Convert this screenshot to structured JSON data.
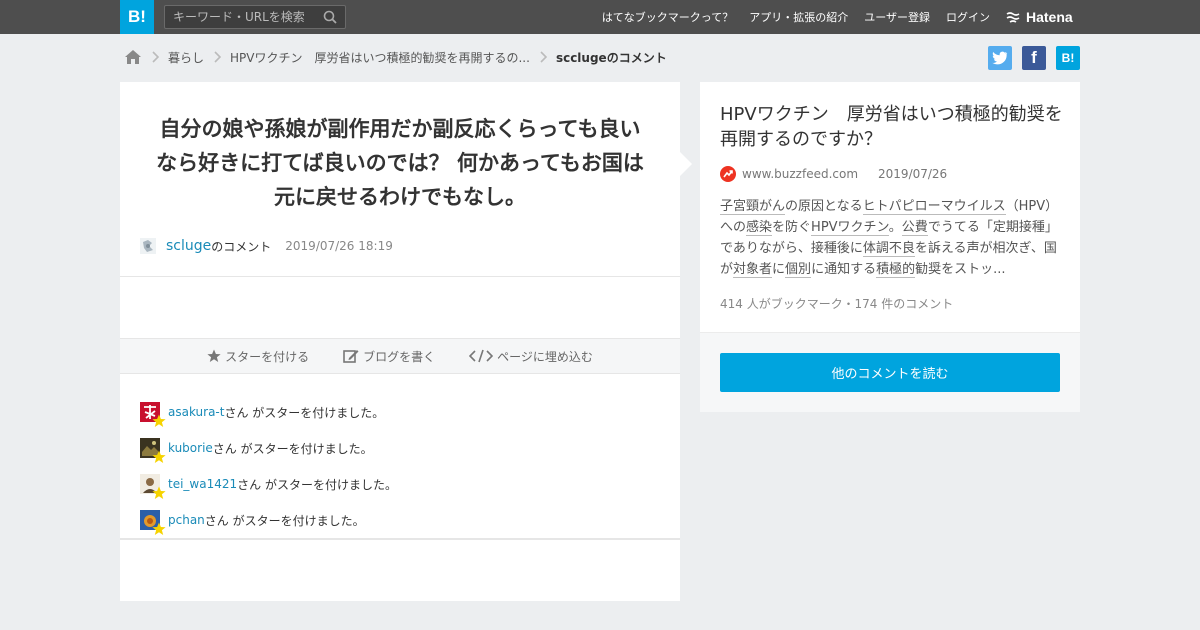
{
  "header": {
    "logo_text": "B!",
    "search_placeholder": "キーワード・URLを検索",
    "nav": [
      "はてなブックマークって？",
      "アプリ・拡張の紹介",
      "ユーザー登録",
      "ログイン"
    ],
    "brand": "Hatena"
  },
  "breadcrumb": {
    "items": [
      "暮らし",
      "HPVワクチン　厚労省はいつ積極的勧奨を再開するの..."
    ],
    "current": "scclugeのコメント"
  },
  "share": {
    "twitter_label": "t",
    "facebook_label": "f",
    "hatena_label": "B!"
  },
  "comment": {
    "text": "自分の娘や孫娘が副作用だか副反応くらっても良いなら好きに打てば良いのでは？ 何かあってもお国は元に戻せるわけでもなし。",
    "user": "scluge",
    "user_suffix": "のコメント",
    "time": "2019/07/26 18:19"
  },
  "actions": {
    "star": "スターを付ける",
    "blog": "ブログを書く",
    "embed": "ページに埋め込む"
  },
  "stars": [
    {
      "user": "asakura-t",
      "text": "さん がスターを付けました。"
    },
    {
      "user": "kuborie",
      "text": "さん がスターを付けました。"
    },
    {
      "user": "tei_wa1421",
      "text": "さん がスターを付けました。"
    },
    {
      "user": "pchan",
      "text": "さん がスターを付けました。"
    }
  ],
  "entry": {
    "title": "HPVワクチン　厚労省はいつ積極的勧奨を再開するのですか？",
    "domain": "www.buzzfeed.com",
    "date": "2019/07/26",
    "desc_parts": [
      "子宮頸がん",
      "の原因となる",
      "ヒトパピローマウイルス",
      "（HPV）への",
      "感染",
      "を防ぐ",
      "HPVワクチン",
      "。",
      "公費",
      "でうてる「定期接種」でありながら、接種後に",
      "体調不良",
      "を訴える声が相次ぎ、国が",
      "対象者",
      "に",
      "個別",
      "に通知する",
      "積極的",
      "勧奨をストッ..."
    ],
    "count": "414 人がブックマーク・174 件のコメント",
    "read_more": "他のコメントを読む"
  },
  "colors": {
    "accent": "#00a4de",
    "topbar": "#4e4e4e",
    "link": "#1a8bb8",
    "twitter": "#55acee",
    "facebook": "#3b5998"
  }
}
